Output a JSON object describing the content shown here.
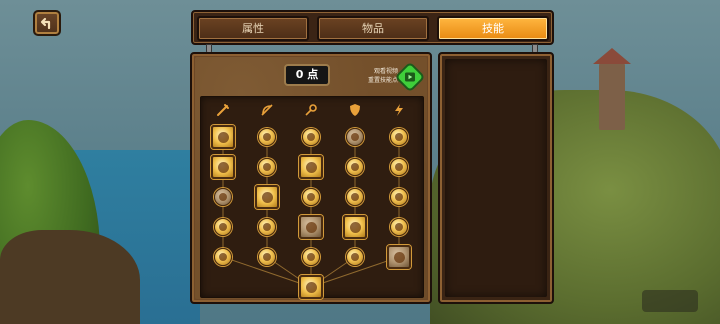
{
  "tabs": [
    {
      "label": "属性",
      "active": false
    },
    {
      "label": "物品",
      "active": false
    },
    {
      "label": "技能",
      "active": true
    }
  ],
  "skill_points": "0 点",
  "reset": {
    "line1": "观看视频",
    "line2": "重置技能点"
  },
  "colors": {
    "accent": "#f29a1e",
    "panel": "#6c4726",
    "reset_green": "#3fcf3a"
  },
  "columns": [
    "sword-icon",
    "bow-icon",
    "magic-icon",
    "shield-icon",
    "lightning-icon"
  ],
  "skills": [
    {
      "row": 0,
      "col": 0,
      "type": "square",
      "icon": "sun-burst-icon"
    },
    {
      "row": 0,
      "col": 1,
      "type": "round",
      "icon": "arrow-icon"
    },
    {
      "row": 0,
      "col": 2,
      "type": "round",
      "icon": "arrow-icon"
    },
    {
      "row": 0,
      "col": 3,
      "type": "round",
      "icon": "shield-icon"
    },
    {
      "row": 0,
      "col": 4,
      "type": "round",
      "icon": "lightning-icon"
    },
    {
      "row": 1,
      "col": 0,
      "type": "square",
      "icon": "swirl-icon"
    },
    {
      "row": 1,
      "col": 1,
      "type": "round",
      "icon": "arrow-icon"
    },
    {
      "row": 1,
      "col": 2,
      "type": "square",
      "icon": "fire-icon"
    },
    {
      "row": 1,
      "col": 3,
      "type": "round",
      "icon": "bow-icon"
    },
    {
      "row": 1,
      "col": 4,
      "type": "round",
      "icon": "bow-icon"
    },
    {
      "row": 2,
      "col": 0,
      "type": "round",
      "icon": "shield-icon"
    },
    {
      "row": 2,
      "col": 1,
      "type": "square",
      "icon": "skull-icon"
    },
    {
      "row": 2,
      "col": 2,
      "type": "round",
      "icon": "arrow-icon"
    },
    {
      "row": 2,
      "col": 3,
      "type": "round",
      "icon": "shield-icon"
    },
    {
      "row": 2,
      "col": 4,
      "type": "round",
      "icon": "cross-icon"
    },
    {
      "row": 3,
      "col": 0,
      "type": "round",
      "icon": "star-icon"
    },
    {
      "row": 3,
      "col": 1,
      "type": "round",
      "icon": "arrow-icon"
    },
    {
      "row": 3,
      "col": 2,
      "type": "square",
      "icon": "lightning-icon"
    },
    {
      "row": 3,
      "col": 3,
      "type": "square",
      "icon": "shield-icon"
    },
    {
      "row": 3,
      "col": 4,
      "type": "round",
      "icon": "lightning-icon"
    },
    {
      "row": 4,
      "col": 0,
      "type": "round",
      "icon": "fist-icon"
    },
    {
      "row": 4,
      "col": 1,
      "type": "round",
      "icon": "arrow-icon"
    },
    {
      "row": 4,
      "col": 2,
      "type": "round",
      "icon": "magic-icon"
    },
    {
      "row": 4,
      "col": 3,
      "type": "round",
      "icon": "radiation-icon"
    },
    {
      "row": 4,
      "col": 4,
      "type": "square",
      "icon": "heal-cross-icon"
    },
    {
      "row": 5,
      "col": 2,
      "type": "square",
      "icon": "vortex-icon"
    }
  ]
}
